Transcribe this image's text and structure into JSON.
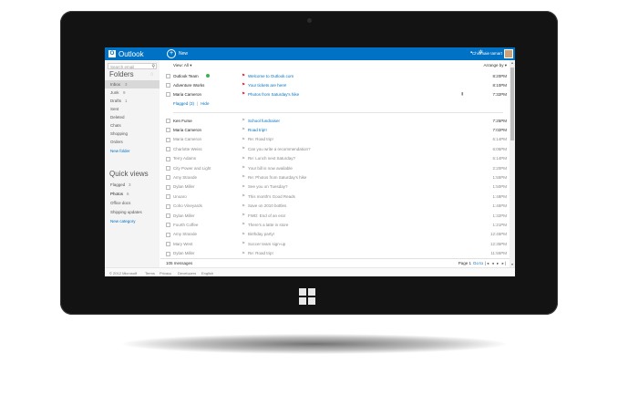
{
  "app": {
    "name": "Outlook",
    "logo_letter": "O"
  },
  "toolbar": {
    "new_label": "New",
    "username": "Chinmaie Iamart"
  },
  "sidebar": {
    "search_placeholder": "Search email",
    "folders_title": "Folders",
    "folders": [
      {
        "label": "Inbox",
        "count": "3"
      },
      {
        "label": "Junk",
        "count": "9"
      },
      {
        "label": "Drafts",
        "count": "1"
      },
      {
        "label": "Sent",
        "count": ""
      },
      {
        "label": "Deleted",
        "count": ""
      },
      {
        "label": "Chats",
        "count": ""
      },
      {
        "label": "Shopping",
        "count": ""
      },
      {
        "label": "Orders",
        "count": ""
      }
    ],
    "new_folder": "New folder",
    "quickviews_title": "Quick views",
    "quickviews": [
      {
        "label": "Flagged",
        "count": "3"
      },
      {
        "label": "Photos",
        "count": "6"
      },
      {
        "label": "Office docs",
        "count": ""
      },
      {
        "label": "Shipping updates",
        "count": ""
      }
    ],
    "new_category": "New category"
  },
  "list": {
    "view_label": "View: All",
    "arrange_label": "Arrange by",
    "flagged_link": "Flagged (3)",
    "hide_link": "Hide",
    "flagged_rows": [
      {
        "from": "Outlook Team",
        "subject": "Welcome to Outlook.com",
        "time": "8:20PM"
      },
      {
        "from": "Adventure Works",
        "subject": "Your tickets are here!",
        "time": "8:10PM"
      },
      {
        "from": "Maria Cameron",
        "subject": "Photos from Saturday's hike",
        "time": "7:32PM"
      }
    ],
    "rows": [
      {
        "from": "Ken Furse",
        "subject": "School fundraiser",
        "time": "7:25PM",
        "state": "unread"
      },
      {
        "from": "Maria Cameron",
        "subject": "Road trip!!",
        "time": "7:02PM",
        "state": "unread"
      },
      {
        "from": "Maria Cameron",
        "subject": "Re: Road trip!",
        "time": "6:14PM",
        "state": "read"
      },
      {
        "from": "Charlotte Weiss",
        "subject": "Can you write a recommendation?",
        "time": "6:05PM",
        "state": "read"
      },
      {
        "from": "Terry Adams",
        "subject": "Re: Lunch next Saturday?",
        "time": "5:14PM",
        "state": "read"
      },
      {
        "from": "City Power and Light",
        "subject": "Your bill is now available",
        "time": "2:20PM",
        "state": "read"
      },
      {
        "from": "Amy Strande",
        "subject": "Re: Photos from Saturday's hike",
        "time": "1:55PM",
        "state": "read"
      },
      {
        "from": "Dylan Miller",
        "subject": "See you on Tuesday?",
        "time": "1:50PM",
        "state": "read"
      },
      {
        "from": "Unoaro",
        "subject": "This month's Good Reads",
        "time": "1:48PM",
        "state": "read"
      },
      {
        "from": "Coho Vineyards",
        "subject": "Save on 2010 bottles",
        "time": "1:45PM",
        "state": "read"
      },
      {
        "from": "Dylan Miller",
        "subject": "FWD: End of an era!",
        "time": "1:32PM",
        "state": "read"
      },
      {
        "from": "Fourth Coffee",
        "subject": "There's a latte in store",
        "time": "1:21PM",
        "state": "read"
      },
      {
        "from": "Amy Strande",
        "subject": "Birthday party!",
        "time": "12:45PM",
        "state": "read"
      },
      {
        "from": "Mary West",
        "subject": "Soccer team sign-up",
        "time": "12:35PM",
        "state": "read"
      },
      {
        "from": "Dylan Miller",
        "subject": "Re: Road trip!",
        "time": "11:55PM",
        "state": "read"
      }
    ],
    "message_count": "105 messages",
    "page_label": "Page 1",
    "goto_label": "Go to",
    "nav_glyphs": "|◂ ◂ ▸ ▸|"
  },
  "footer": {
    "copyright": "© 2012 Microsoft",
    "links": [
      "Terms",
      "Privacy",
      "Developers",
      "English"
    ]
  },
  "colors": {
    "accent": "#0072c6",
    "bezel": "#131313",
    "flag": "#d32f2f",
    "presence": "#3cb34a"
  }
}
